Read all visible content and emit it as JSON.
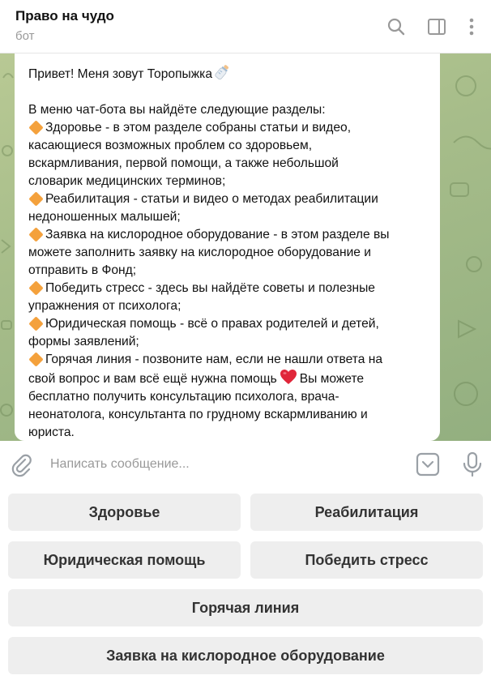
{
  "header": {
    "title": "Право на чудо",
    "subtitle": "бот",
    "icons": [
      "search-icon",
      "sidebar-icon",
      "more-icon"
    ]
  },
  "message": {
    "greeting": "Привет! Меня зовут Торопыжка",
    "intro": "В меню чат-бота вы найдёте следующие разделы:",
    "items": [
      "Здоровье - в этом разделе собраны статьи и видео,",
      "касающиеся возможных проблем со здоровьем,",
      "вскармливания, первой помощи, а также небольшой",
      "словарик медицинских терминов;",
      "Реабилитация - статьи и видео о методах реабилитации",
      "недоношенных малышей;",
      "Заявка на кислородное оборудование - в этом разделе вы",
      "можете заполнить заявку на кислородное оборудование и",
      "отправить в Фонд;",
      "Победить стресс - здесь вы найдёте советы и полезные",
      "упражнения от психолога;",
      "Юридическая помощь - всё о правах родителей и детей,",
      "формы заявлений;",
      "Горячая линия - позвоните нам, если не нашли ответа на",
      "свой вопрос и вам всё ещё нужна помощь",
      "Вы можете",
      "бесплатно получить консультацию психолога, врача-",
      "неонатолога, консультанта по грудному вскармливанию и",
      "юриста."
    ]
  },
  "composer": {
    "placeholder": "Написать сообщение..."
  },
  "keyboard": {
    "health": "Здоровье",
    "rehab": "Реабилитация",
    "legal": "Юридическая помощь",
    "stress": "Победить стресс",
    "hotline": "Горячая линия",
    "oxygen": "Заявка на кислородное оборудование"
  },
  "colors": {
    "bullet": "#f4a13c",
    "heart": "#e0263a",
    "chat_background": "#a7bd8a",
    "button_background": "#eeeeee"
  }
}
